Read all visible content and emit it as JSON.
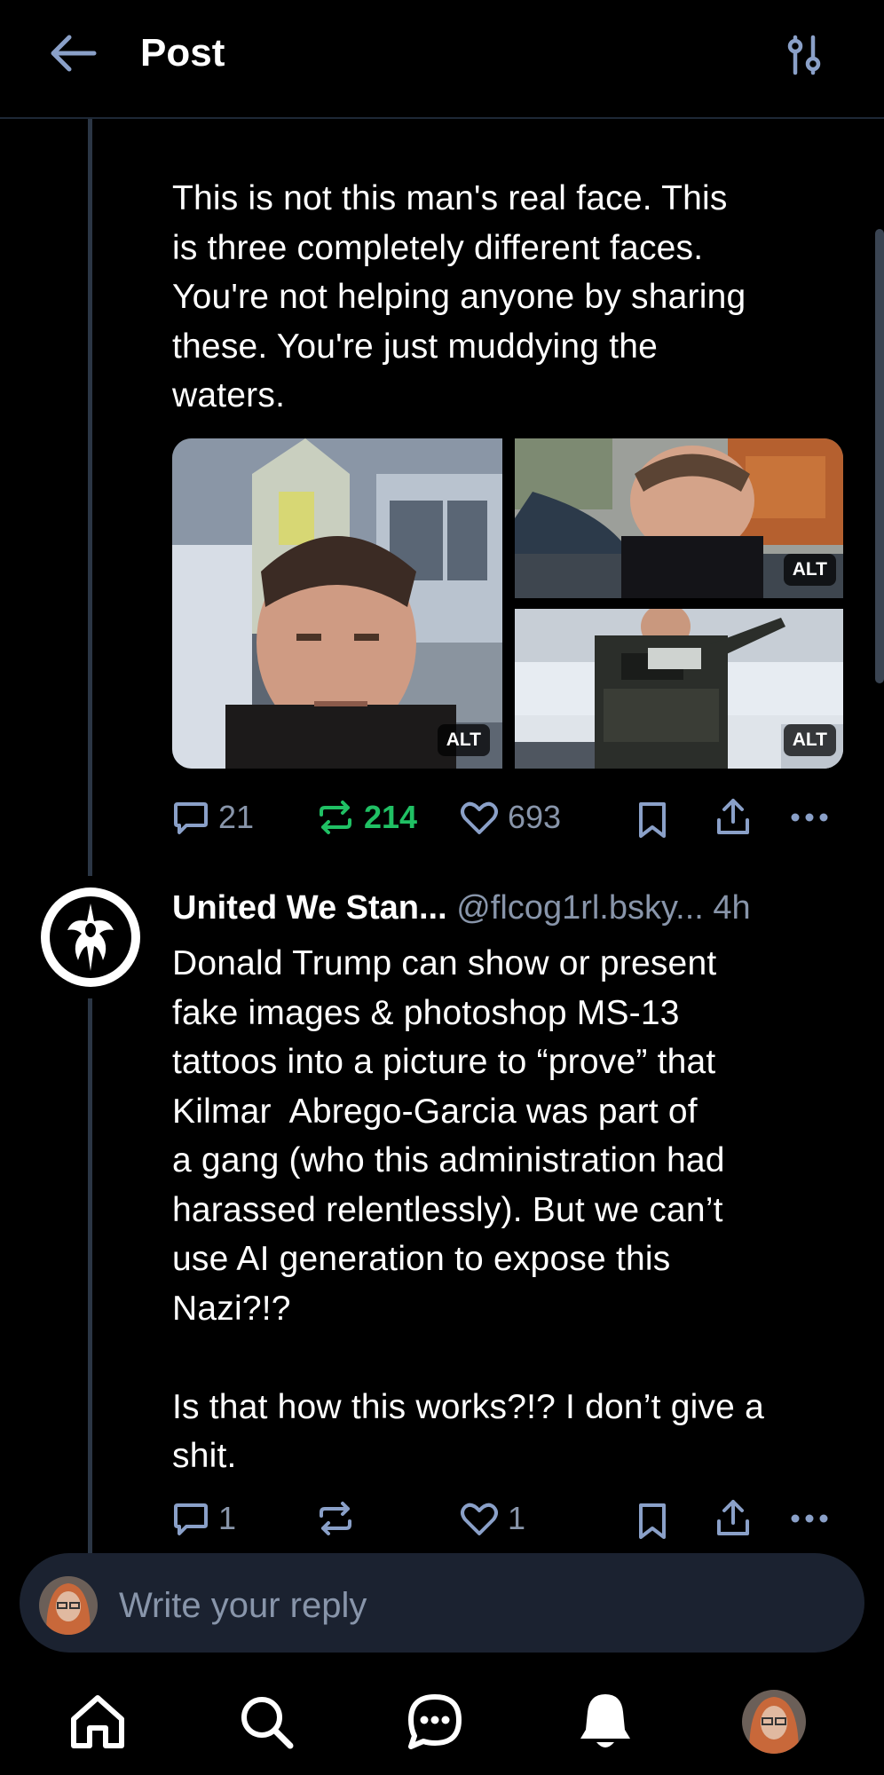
{
  "header": {
    "title": "Post"
  },
  "post1": {
    "text": "This is not this man's real face. This\nis three completely different faces.\nYou're not helping anyone by sharing\nthese. You're just muddying the\nwaters.",
    "images": [
      {
        "alt_badge": "ALT"
      },
      {
        "alt_badge": "ALT"
      },
      {
        "alt_badge": "ALT"
      }
    ],
    "actions": {
      "reply_count": "21",
      "repost_count": "214",
      "like_count": "693"
    }
  },
  "post2": {
    "author_name": "United We Stan...",
    "author_handle": "@flcog1rl.bsky...",
    "time": "4h",
    "text": "Donald Trump can show or present\nfake images & photoshop MS-13\ntattoos into a picture to “prove” that\nKilmar  Abrego-Garcia was part of\na gang (who this administration had\nharassed relentlessly). But we can’t\nuse AI generation to expose this\nNazi?!?\n\nIs that how this works?!? I don’t give a\nshit.",
    "actions": {
      "reply_count": "1",
      "repost_count": "",
      "like_count": "1"
    }
  },
  "composer": {
    "placeholder": "Write your reply"
  },
  "colors": {
    "background": "#000000",
    "muted": "#8895aa",
    "repost_active": "#20c064",
    "composer_bg": "#1b2230",
    "thread_line": "#2b3645"
  },
  "icons": {
    "back": "arrow-left-icon",
    "filter": "sliders-icon",
    "reply": "speech-bubble-icon",
    "repost": "repost-icon",
    "like": "heart-icon",
    "bookmark": "bookmark-icon",
    "share": "share-icon",
    "more": "ellipsis-icon",
    "nav": [
      "home-icon",
      "search-icon",
      "chat-icon",
      "bell-icon",
      "profile-avatar"
    ]
  }
}
